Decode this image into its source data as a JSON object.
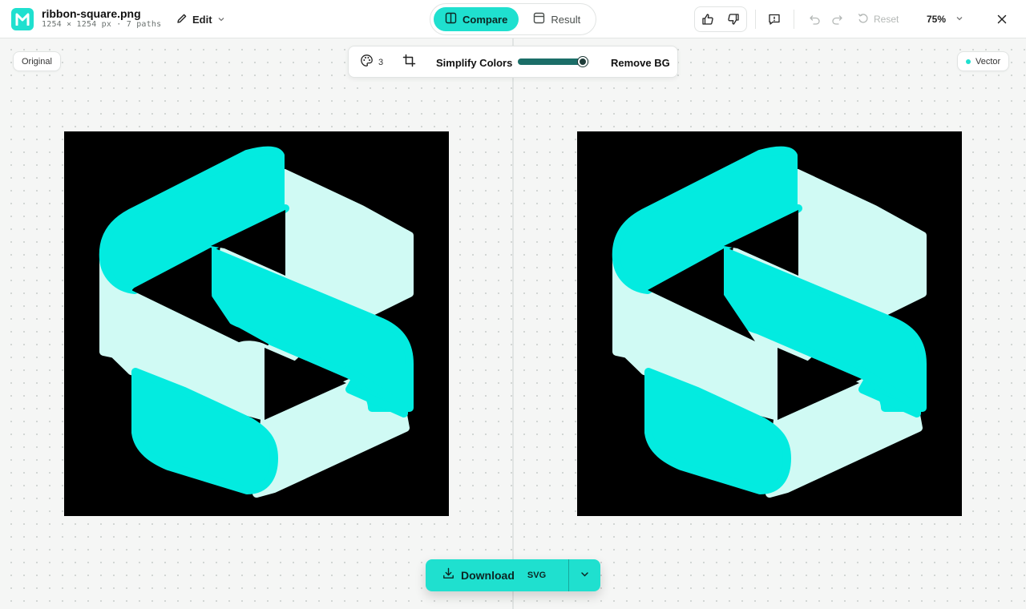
{
  "file": {
    "name": "ribbon-square.png",
    "meta": "1254 × 1254 px · 7 paths"
  },
  "header": {
    "edit_label": "Edit",
    "view_tabs": [
      {
        "label": "Compare",
        "active": true
      },
      {
        "label": "Result",
        "active": false
      }
    ],
    "reset_label": "Reset",
    "zoom_label": "75%"
  },
  "panels": {
    "left_label": "Original",
    "right_label": "Vector"
  },
  "toolbar": {
    "palette_count": "3",
    "simplify_label": "Simplify Colors",
    "simplify_level": 0.9,
    "remove_bg_label": "Remove BG"
  },
  "download": {
    "label": "Download",
    "format": "SVG"
  },
  "colors": {
    "accent": "#1fe0cf",
    "ribbon_primary": "#03ebe0",
    "ribbon_light": "#d0faf4",
    "canvas_bg": "#000000"
  },
  "icons": [
    "app-logo-icon",
    "pencil-icon",
    "chevron-down-icon",
    "columns-icon",
    "window-icon",
    "thumbs-up-icon",
    "thumbs-down-icon",
    "feedback-icon",
    "undo-icon",
    "redo-icon",
    "reset-icon",
    "close-icon",
    "palette-icon",
    "crop-icon",
    "download-icon"
  ]
}
